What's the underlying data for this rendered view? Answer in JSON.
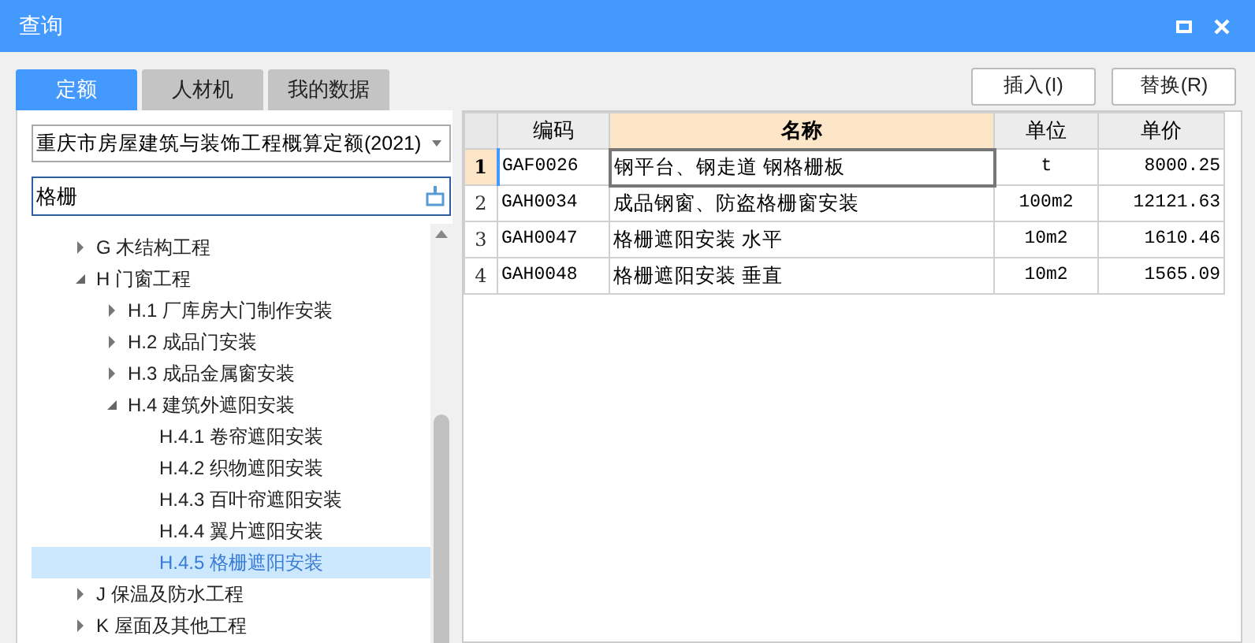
{
  "window": {
    "title": "查询"
  },
  "tabs": [
    {
      "label": "定额",
      "selected": true
    },
    {
      "label": "人材机",
      "selected": false
    },
    {
      "label": "我的数据",
      "selected": false
    }
  ],
  "library_select": {
    "value": "重庆市房屋建筑与装饰工程概算定额(2021)"
  },
  "search": {
    "value": "格栅"
  },
  "tree": [
    {
      "label": "G 木结构工程",
      "expanded": false,
      "selected": false
    },
    {
      "label": "H 门窗工程",
      "expanded": true,
      "selected": false,
      "children": [
        {
          "label": "H.1 厂库房大门制作安装",
          "expanded": false,
          "selected": false
        },
        {
          "label": "H.2 成品门安装",
          "expanded": false,
          "selected": false
        },
        {
          "label": "H.3 成品金属窗安装",
          "expanded": false,
          "selected": false
        },
        {
          "label": "H.4 建筑外遮阳安装",
          "expanded": true,
          "selected": false,
          "children": [
            {
              "label": "H.4.1 卷帘遮阳安装",
              "kind": "leaf",
              "selected": false
            },
            {
              "label": "H.4.2 织物遮阳安装",
              "kind": "leaf",
              "selected": false
            },
            {
              "label": "H.4.3 百叶帘遮阳安装",
              "kind": "leaf",
              "selected": false
            },
            {
              "label": "H.4.4 翼片遮阳安装",
              "kind": "leaf",
              "selected": false
            },
            {
              "label": "H.4.5 格栅遮阳安装",
              "kind": "leaf",
              "selected": true
            }
          ]
        }
      ]
    },
    {
      "label": "J 保温及防水工程",
      "expanded": false,
      "selected": false
    },
    {
      "label": "K 屋面及其他工程",
      "expanded": false,
      "selected": false
    }
  ],
  "buttons": [
    "插入(I)",
    "替换(R)"
  ],
  "table": {
    "columns": [
      {
        "label": "编码",
        "selected": false
      },
      {
        "label": "名称",
        "selected": true
      },
      {
        "label": "单位",
        "selected": false
      },
      {
        "label": "单价",
        "selected": false
      }
    ],
    "rows": [
      {
        "index": "1",
        "selected": true,
        "cells": [
          "GAF0026",
          "钢平台、钢走道 钢格栅板",
          "t",
          "8000.25"
        ]
      },
      {
        "index": "2",
        "selected": false,
        "cells": [
          "GAH0034",
          "成品钢窗、防盗格栅窗安装",
          "100m2",
          "12121.63"
        ]
      },
      {
        "index": "3",
        "selected": false,
        "cells": [
          "GAH0047",
          "格栅遮阳安装 水平",
          "10m2",
          "1610.46"
        ]
      },
      {
        "index": "4",
        "selected": false,
        "cells": [
          "GAH0048",
          "格栅遮阳安装 垂直",
          "10m2",
          "1565.09"
        ]
      }
    ]
  }
}
